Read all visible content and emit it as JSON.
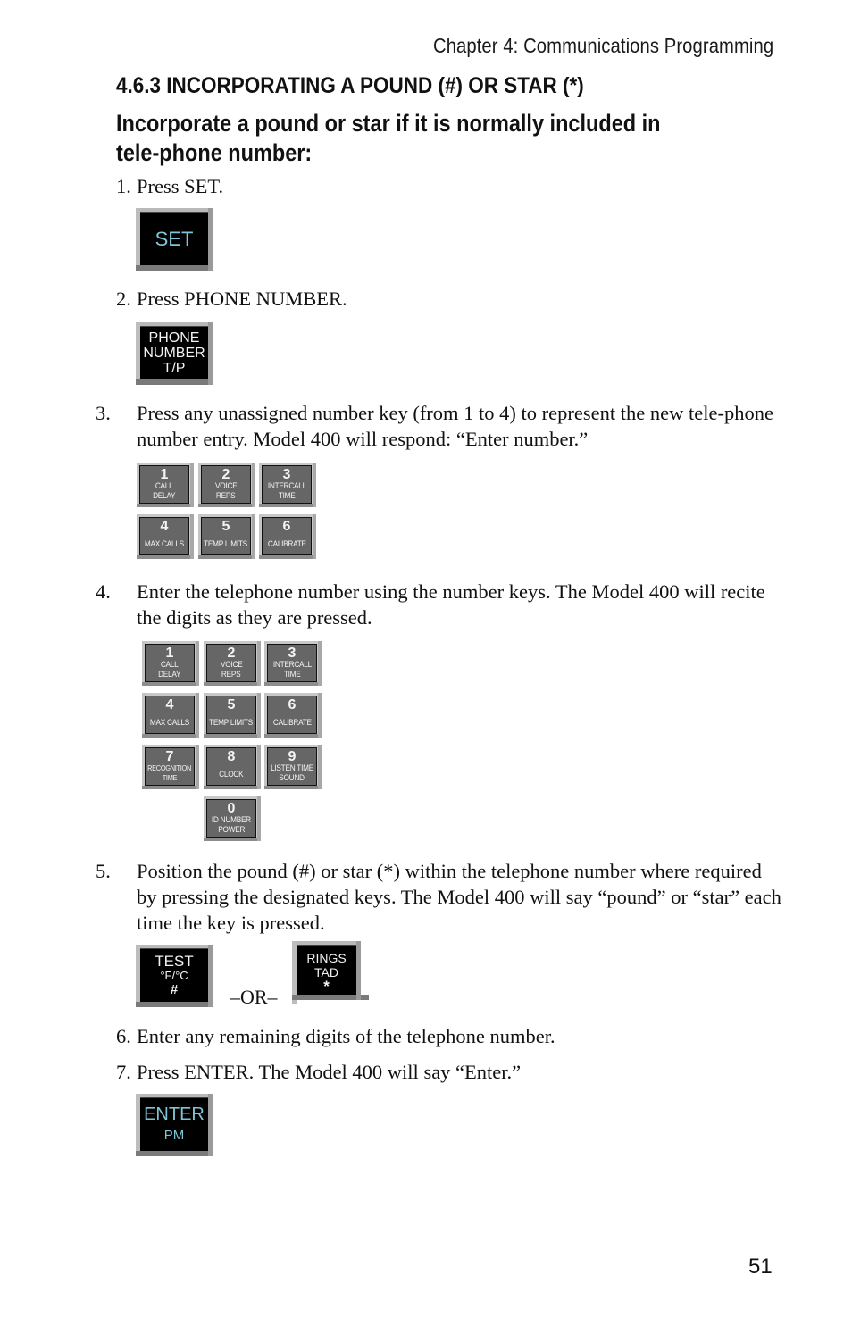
{
  "header": {
    "running_head": "Chapter 4: Communications Programming"
  },
  "section": {
    "title": "4.6.3 INCORPORATING A POUND (#) OR STAR (*)",
    "subtitle": "Incorporate a pound or star if it is normally included in tele-phone number:"
  },
  "steps": [
    {
      "num": "1.",
      "text": "Press SET."
    },
    {
      "num": "2.",
      "text": "Press PHONE NUMBER."
    },
    {
      "num": "3.",
      "text": "Press any unassigned number key (from 1 to 4) to represent the new tele-phone number entry. Model 400 will respond: “Enter number.”"
    },
    {
      "num": "4.",
      "text": "Enter the telephone number using the number keys. The Model 400 will recite the digits as they are pressed."
    },
    {
      "num": "5.",
      "text": "Position the pound (#) or star (*) within the telephone number where required by pressing the designated keys. The Model 400 will say “pound” or “star” each time the key is pressed."
    },
    {
      "num": "6.",
      "text": "Enter any remaining digits of the telephone number."
    },
    {
      "num": "7.",
      "text": "Press ENTER. The Model 400 will say “Enter.”"
    }
  ],
  "keys": {
    "set": {
      "line1": "SET"
    },
    "phone_number": {
      "line1": "PHONE",
      "line2": "NUMBER",
      "line3": "T/P"
    },
    "test": {
      "line1": "TEST",
      "line2": "°F/°C",
      "line3": "#"
    },
    "rings": {
      "line1": "RINGS",
      "line2": "TAD",
      "line3": "*"
    },
    "enter": {
      "line1": "ENTER",
      "line2": "PM"
    },
    "keypad": [
      {
        "digit": "1",
        "label1": "CALL",
        "label2": "DELAY"
      },
      {
        "digit": "2",
        "label1": "VOICE",
        "label2": "REPS"
      },
      {
        "digit": "3",
        "label1": "INTERCALL",
        "label2": "TIME"
      },
      {
        "digit": "4",
        "label1": "",
        "label2": "MAX CALLS"
      },
      {
        "digit": "5",
        "label1": "",
        "label2": "TEMP LIMITS"
      },
      {
        "digit": "6",
        "label1": "",
        "label2": "CALIBRATE"
      },
      {
        "digit": "7",
        "label1": "RECOGNITION",
        "label2": "TIME"
      },
      {
        "digit": "8",
        "label1": "",
        "label2": "CLOCK"
      },
      {
        "digit": "9",
        "label1": "LISTEN TIME",
        "label2": "SOUND"
      },
      {
        "digit": "0",
        "label1": "ID NUMBER",
        "label2": "POWER"
      }
    ]
  },
  "or_separator": "–OR–",
  "footer": {
    "page_number": "51"
  },
  "colors": {
    "key_label_cyan": "#7fc4d6",
    "key_black": "#000000",
    "key_grey": "#666666"
  }
}
